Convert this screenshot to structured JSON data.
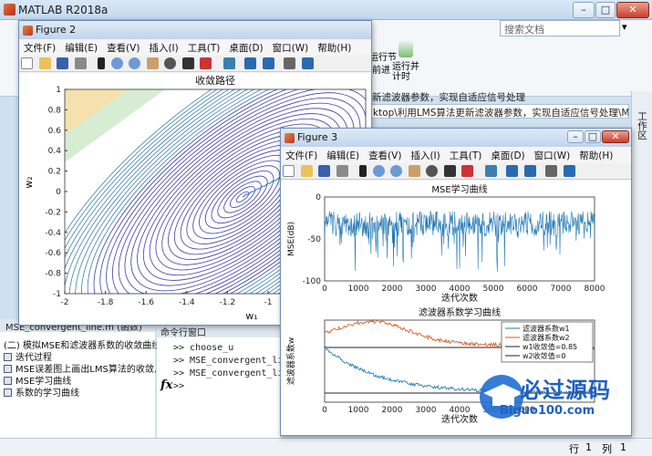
{
  "app": {
    "title": "MATLAB R2018a",
    "search_placeholder": "搜索文档"
  },
  "ribbon": {
    "run_section_label": "运行节",
    "advance_label": "前进",
    "run_time_label": "运行并\n计时"
  },
  "address": {
    "line1": "新滤波器参数，实现自适应信号处理",
    "line2": "ktop\\利用LMS算法更新滤波器参数，实现自适应信号处理\\MSE_co..."
  },
  "right_tab": "工作区",
  "left_panel": {
    "header": "MSE_convergent_line.m  (函数)",
    "items": [
      "(二) 模拟MSE和滤波器系数的收敛曲线",
      "迭代过程",
      "MSE误差图上画出LMS算法的收敛...",
      "MSE学习曲线",
      "系数的学习曲线"
    ]
  },
  "command_window": {
    "header": "命令行窗口",
    "lines": [
      ">> choose_u",
      ">> MSE_convergent_line",
      ">> MSE_convergent_line",
      ">>"
    ],
    "fx": "fx"
  },
  "status": {
    "row_label": "行",
    "row": "1",
    "col_label": "列",
    "col": "1"
  },
  "figure2": {
    "title": "Figure 2",
    "menu": [
      "文件(F)",
      "编辑(E)",
      "查看(V)",
      "插入(I)",
      "工具(T)",
      "桌面(D)",
      "窗口(W)",
      "帮助(H)"
    ],
    "plot_title": "收敛路径",
    "xlabel": "w₁",
    "ylabel": "w₂",
    "xticks": [
      "-2",
      "-1.8",
      "-1.6",
      "-1.4",
      "-1.2",
      "-1",
      "-0.8",
      "-0.6"
    ],
    "yticks": [
      "1",
      "0.8",
      "0.6",
      "0.4",
      "0.2",
      "0",
      "-0.2",
      "-0.4",
      "-0.6",
      "-0.8",
      "-1"
    ]
  },
  "figure3": {
    "title": "Figure 3",
    "menu": [
      "文件(F)",
      "编辑(E)",
      "查看(V)",
      "插入(I)",
      "工具(T)",
      "桌面(D)",
      "窗口(W)",
      "帮助(H)"
    ],
    "mse": {
      "title": "MSE学习曲线",
      "xlabel": "迭代次数",
      "ylabel": "MSE(dB)",
      "yticks": [
        "0",
        "-50",
        "-100"
      ],
      "xticks": [
        "0",
        "1000",
        "2000",
        "3000",
        "4000",
        "5000",
        "6000",
        "7000",
        "8000"
      ]
    },
    "coef": {
      "title": "滤波器系数学习曲线",
      "xlabel": "迭代次数",
      "ylabel": "滤波器系数w",
      "xticks": [
        "0",
        "1000",
        "2000",
        "3000",
        "4000",
        "5000",
        "600"
      ],
      "legend": [
        "滤波器系数w1",
        "滤波器系数w2",
        "w1收敛值=0.85",
        "w2收敛值=0"
      ]
    }
  },
  "watermark": {
    "text": "必过源码",
    "url": "Biguo100.com"
  },
  "colors": {
    "series1": "#1f77b4",
    "series2": "#d95319",
    "contour": "#3d3ea8",
    "ref": "#222222"
  }
}
